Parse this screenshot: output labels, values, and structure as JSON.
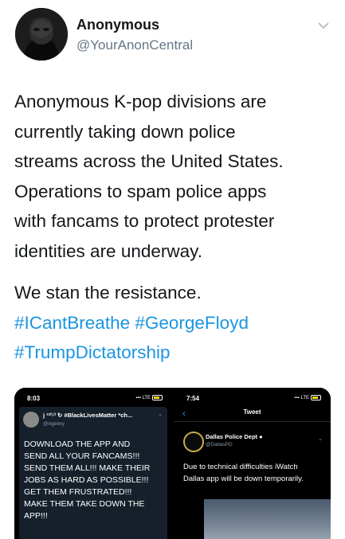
{
  "tweet": {
    "author_name": "Anonymous",
    "author_handle": "@YourAnonCentral",
    "text_lines": [
      "Anonymous K-pop divisions are",
      "currently taking down police",
      "streams across the United States.",
      "Operations to spam police apps",
      "with fancams to protect protester",
      "identities are underway."
    ],
    "second_line": "We stan the resistance.",
    "hashtags_line1": [
      "#ICantBreathe",
      "#GeorgeFloyd"
    ],
    "hashtags_line2": [
      "#TrumpDictatorship"
    ],
    "colors": {
      "link": "#1b95e0",
      "text": "#14171a",
      "secondary": "#657786"
    }
  },
  "media": {
    "left": {
      "time": "8:03",
      "signal": "LTE",
      "card_name": "j ¹²⁽⁷⁾ ↻ #BlackLivesMatter *ch...",
      "card_handle": "@ngelwy",
      "card_text_lines": [
        "DOWNLOAD THE APP AND",
        "SEND ALL YOUR FANCAMS!!!",
        "SEND THEM ALL!!! MAKE THEIR",
        "JOBS AS HARD AS POSSIBLE!!!",
        "GET THEM FRUSTRATED!!!",
        "MAKE THEM TAKE DOWN THE",
        "APP!!!"
      ]
    },
    "right": {
      "time": "7:54",
      "signal": "LTE",
      "title": "Tweet",
      "account_name": "Dallas Police Dept",
      "account_handle": "@DallasPD",
      "text_lines": [
        "Due to technical difficulties iWatch",
        "Dallas app will be down temporarily."
      ]
    }
  }
}
